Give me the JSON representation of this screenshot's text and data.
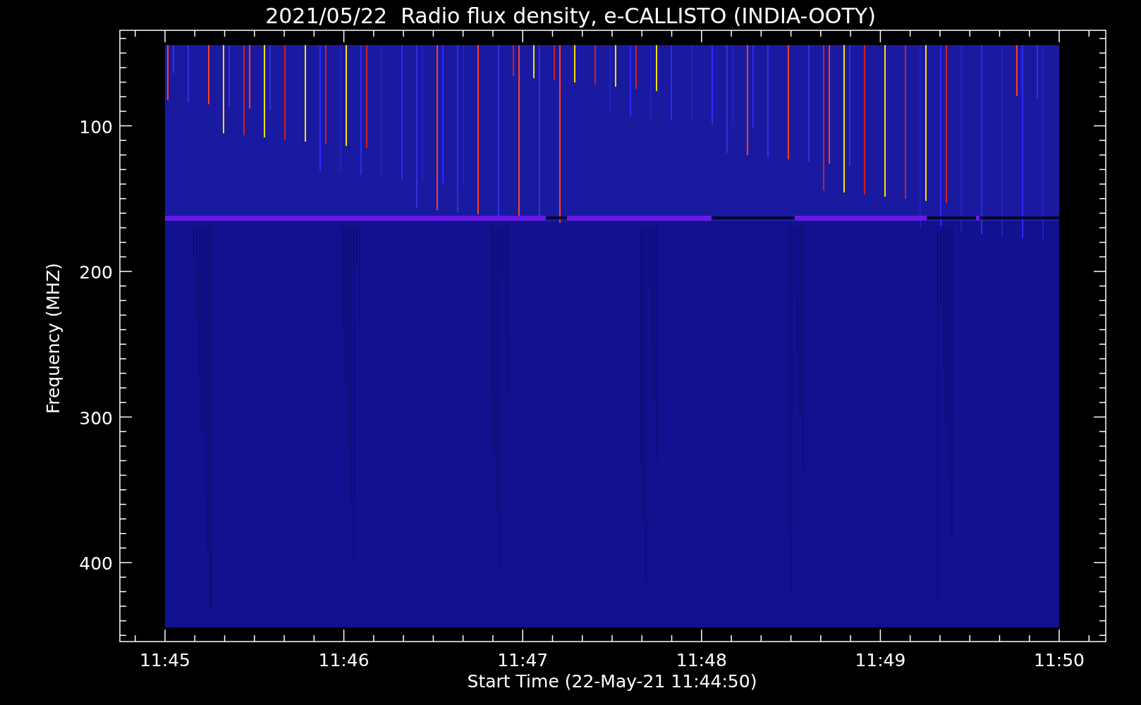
{
  "title": "2021/05/22  Radio flux density, e-CALLISTO (INDIA-OOTY)",
  "y_axis": {
    "label": "Frequency (MHZ)",
    "ticks": [
      "100",
      "200",
      "300",
      "400"
    ]
  },
  "x_axis": {
    "label": "Start Time (22-May-21 11:44:50)",
    "ticks": [
      "11:45",
      "11:46",
      "11:47",
      "11:48",
      "11:49",
      "11:50"
    ]
  }
}
